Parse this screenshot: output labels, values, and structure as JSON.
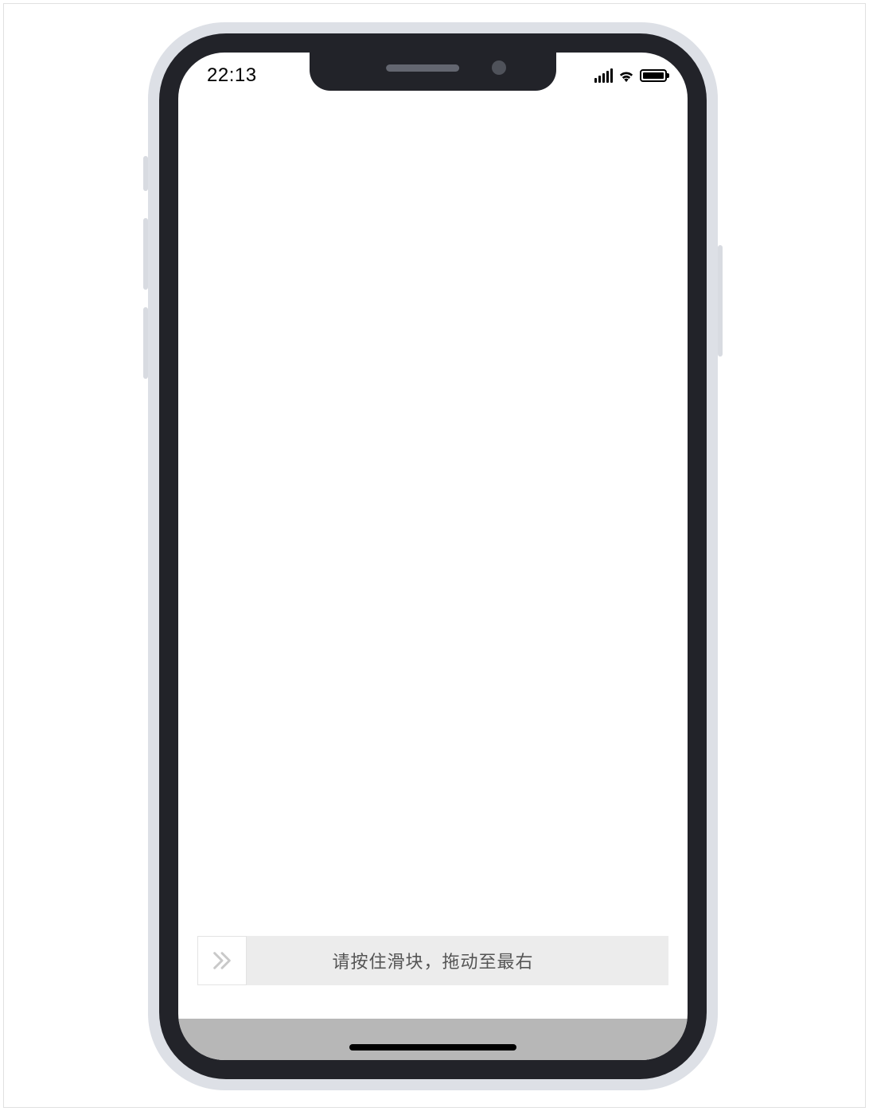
{
  "statusBar": {
    "time": "22:13"
  },
  "slider": {
    "instruction": "请按住滑块，拖动至最右"
  }
}
